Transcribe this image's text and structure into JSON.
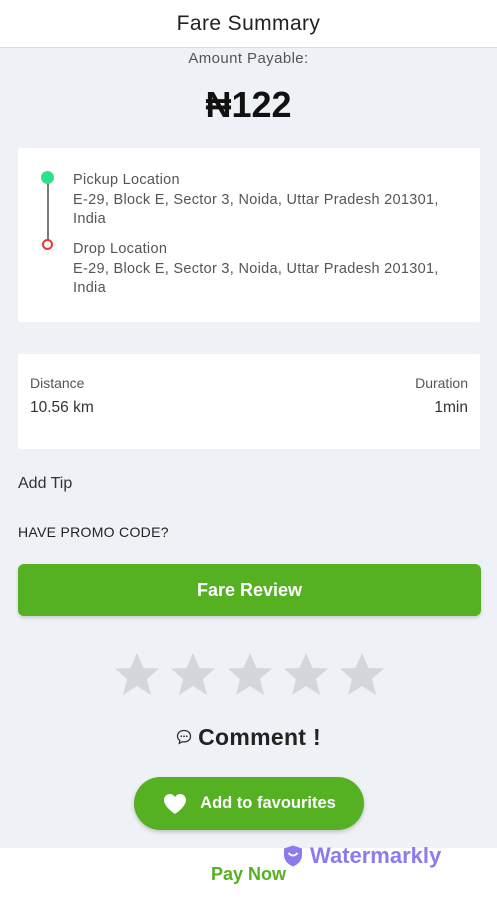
{
  "header": {
    "title": "Fare Summary"
  },
  "amount": {
    "label": "Amount Payable:",
    "value": "₦122"
  },
  "locations": {
    "pickup": {
      "label": "Pickup Location",
      "address": "E-29, Block E, Sector 3, Noida, Uttar Pradesh 201301, India"
    },
    "drop": {
      "label": "Drop Location",
      "address": "E-29, Block E, Sector 3, Noida, Uttar Pradesh 201301, India"
    }
  },
  "trip": {
    "distance_label": "Distance",
    "distance_value": "10.56 km",
    "duration_label": "Duration",
    "duration_value": "1min"
  },
  "add_tip": "Add Tip",
  "promo": "HAVE PROMO CODE?",
  "fare_review": "Fare Review",
  "rating": {
    "stars_total": 5,
    "stars_filled": 0
  },
  "comment": {
    "text": "Comment !",
    "icon": "speech-bubble-icon"
  },
  "favourites": {
    "label": "Add to favourites",
    "icon": "heart-icon"
  },
  "pay_now": "Pay Now",
  "watermark": {
    "text": "Watermarkly",
    "icon": "shield-icon"
  },
  "colors": {
    "accent_green": "#55b022",
    "pickup_dot": "#2ee08a",
    "drop_pin": "#e53935",
    "star_empty": "#d3d6db",
    "watermark": "#8b7bf0",
    "background": "#eef1f6"
  }
}
